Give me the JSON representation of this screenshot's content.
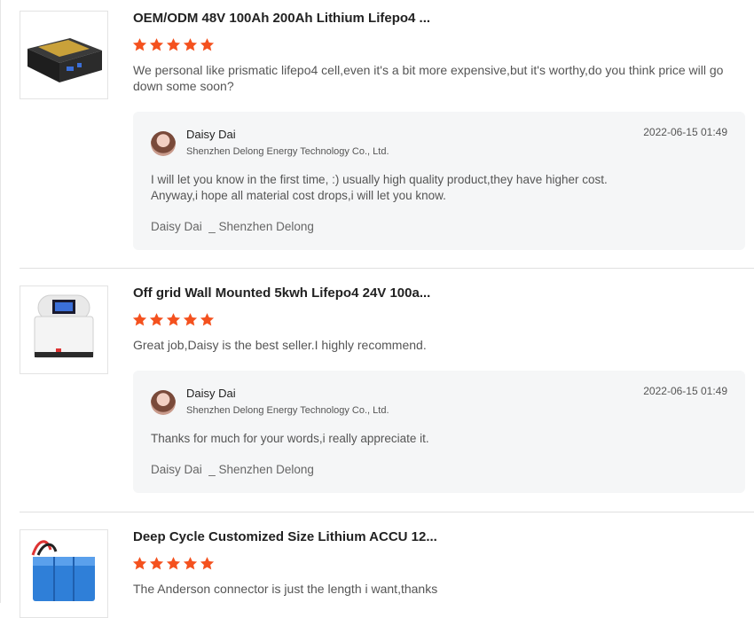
{
  "reviews": [
    {
      "product_title": "OEM/ODM 48V 100Ah 200Ah Lithium Lifepo4 ...",
      "stars": 5,
      "text": "We personal like prismatic lifepo4 cell,even it's a bit more expensive,but it's worthy,do you think price will go down some soon?",
      "reply": {
        "name": "Daisy Dai",
        "company": "Shenzhen Delong Energy Technology Co., Ltd.",
        "date": "2022-06-15 01:49",
        "line1": "I will let you know in the first time, :) usually high quality product,they have higher cost.",
        "line2": "Anyway,i hope all material cost drops,i will let you know.",
        "sign": "Daisy Dai  _ Shenzhen Delong"
      }
    },
    {
      "product_title": "Off grid Wall Mounted 5kwh Lifepo4 24V 100a...",
      "stars": 5,
      "text": "Great job,Daisy is the best seller.I highly recommend.",
      "reply": {
        "name": "Daisy Dai",
        "company": "Shenzhen Delong Energy Technology Co., Ltd.",
        "date": "2022-06-15 01:49",
        "line1": "Thanks for much for your words,i really appreciate it.",
        "sign": "Daisy Dai  _ Shenzhen Delong"
      }
    },
    {
      "product_title": "Deep Cycle Customized Size Lithium ACCU 12...",
      "stars": 5,
      "text": "The Anderson connector is just the length i want,thanks"
    }
  ],
  "colors": {
    "star": "#f4511e",
    "reply_bg": "#f5f6f7"
  }
}
